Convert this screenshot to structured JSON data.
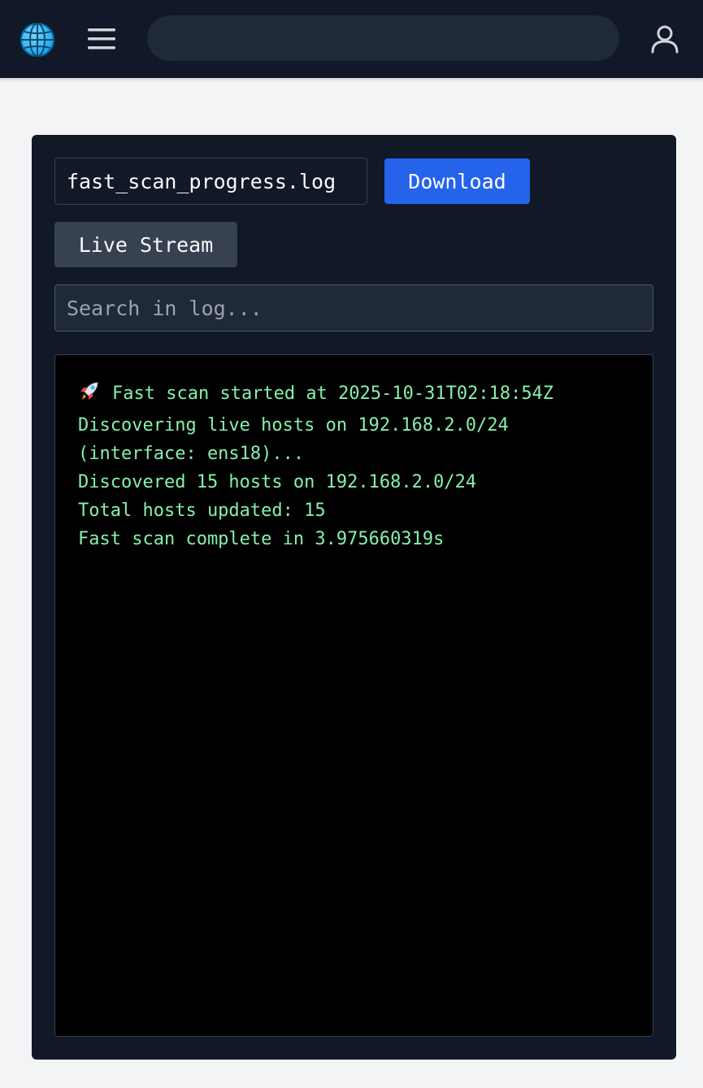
{
  "topbar": {
    "search_value": "",
    "icons": {
      "globe": "globe-icon",
      "menu": "hamburger-menu-icon",
      "user": "user-icon"
    }
  },
  "log_viewer": {
    "file_name": "fast_scan_progress.log",
    "download_label": "Download",
    "live_stream_label": "Live Stream",
    "search_placeholder": "Search in log...",
    "lines": [
      "Fast scan started at 2025-10-31T02:18:54Z",
      "Discovering live hosts on 192.168.2.0/24",
      "(interface: ens18)...",
      "Discovered 15 hosts on 192.168.2.0/24",
      "Total hosts updated: 15",
      "Fast scan complete in 3.975660319s"
    ],
    "first_line_icon": "rocket-icon"
  },
  "colors": {
    "topbar_bg": "#111827",
    "page_bg": "#f3f4f6",
    "card_bg": "#111827",
    "accent_button": "#2563eb",
    "secondary_button": "#374151",
    "log_text": "#86efac",
    "log_bg": "#000000"
  }
}
